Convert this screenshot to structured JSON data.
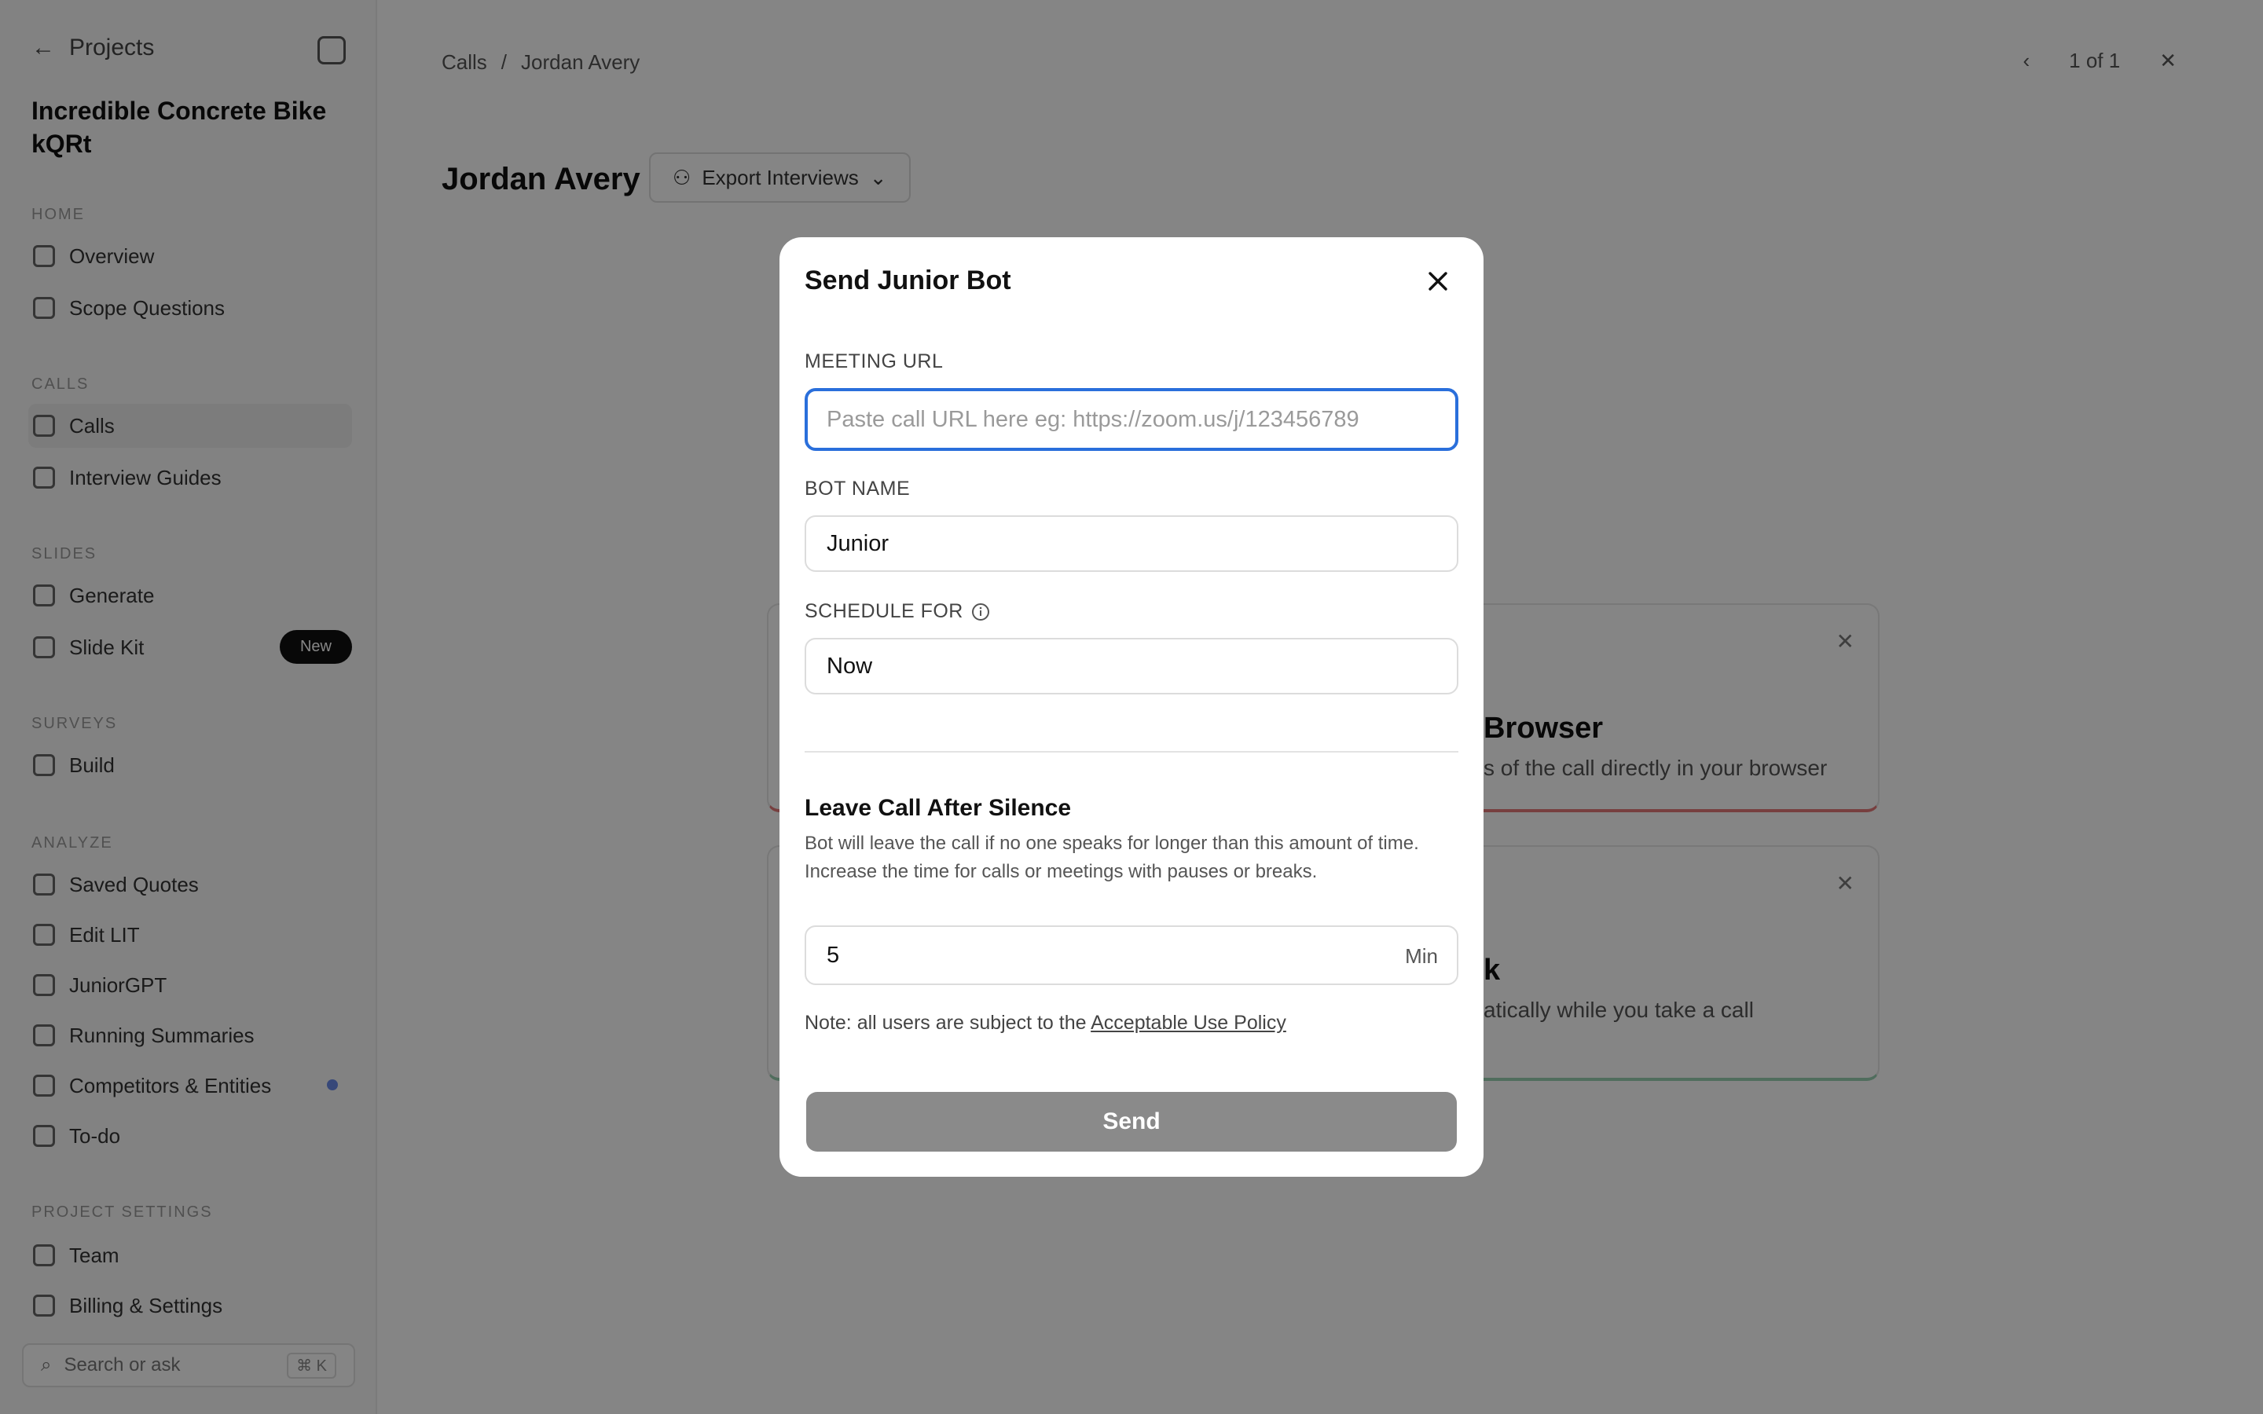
{
  "background": {
    "sidebar": {
      "back_label": "Projects",
      "project_title": "Incredible Concrete Bike kQRt",
      "sections": [
        {
          "label": "HOME",
          "items": [
            "Overview",
            "Scope Questions"
          ]
        },
        {
          "label": "CALLS",
          "items": [
            "Calls",
            "Interview Guides"
          ]
        },
        {
          "label": "SLIDES",
          "items": [
            "Generate",
            "Slide Kit"
          ]
        },
        {
          "label": "SURVEYS",
          "items": [
            "Build"
          ]
        },
        {
          "label": "ANALYZE",
          "items": [
            "Saved Quotes",
            "Edit LIT",
            "JuniorGPT",
            "Running Summaries",
            "Competitors & Entities",
            "To-do"
          ]
        },
        {
          "label": "PROJECT SETTINGS",
          "items": [
            "Team",
            "Billing & Settings"
          ]
        }
      ],
      "new_badge": "New",
      "search_placeholder": "Search or ask",
      "search_shortcut": "⌘ K"
    },
    "breadcrumb": [
      "Calls",
      "/",
      "Jordan Avery"
    ],
    "pager": "1 of 1",
    "page_title": "Jordan Avery",
    "export_label": "Export Interviews",
    "card1": {
      "heading": "Browser",
      "sub": "s of the call directly in your browser"
    },
    "card2": {
      "heading": "k",
      "sub": "atically while you take a call"
    }
  },
  "modal": {
    "title": "Send Junior Bot",
    "meeting_url": {
      "label": "MEETING URL",
      "value": "",
      "placeholder": "Paste call URL here eg: https://zoom.us/j/123456789"
    },
    "bot_name": {
      "label": "BOT NAME",
      "value": "Junior"
    },
    "schedule": {
      "label": "SCHEDULE FOR",
      "value": "Now"
    },
    "silence": {
      "title": "Leave Call After Silence",
      "description": "Bot will leave the call if no one speaks for longer than this amount of time. Increase the time for calls or meetings with pauses or breaks.",
      "value": "5",
      "unit": "Min"
    },
    "note_prefix": "Note: all users are subject to the",
    "note_link": "Acceptable Use Policy",
    "send_label": "Send"
  },
  "colors": {
    "focus_border": "#2a6fdb",
    "send_disabled": "#8a8a8a",
    "overlay": "rgba(0,0,0,0.48)"
  }
}
